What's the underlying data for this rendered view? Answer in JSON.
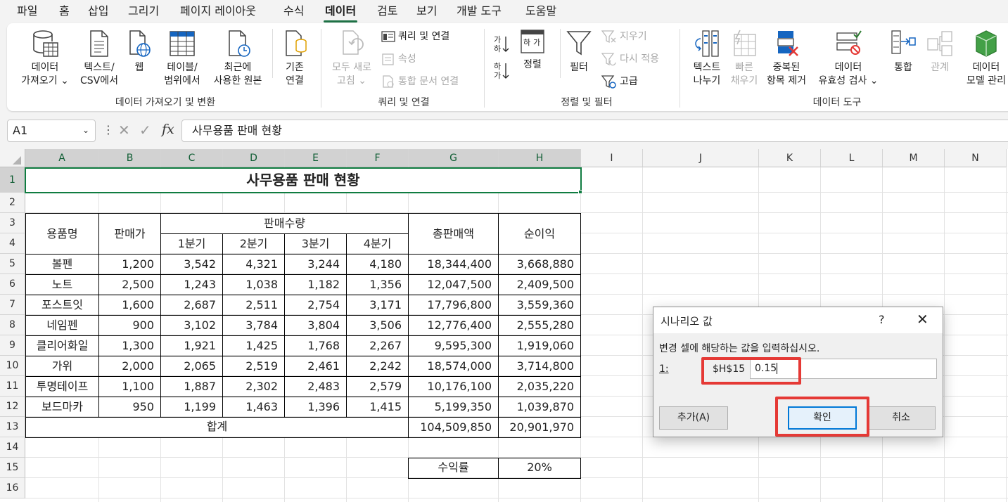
{
  "menu_tabs": [
    "파일",
    "홈",
    "삽입",
    "그리기",
    "페이지 레이아웃",
    "수식",
    "데이터",
    "검토",
    "보기",
    "개발 도구",
    "도움말"
  ],
  "active_tab": "데이터",
  "ribbon": {
    "get_data": {
      "line1": "데이터",
      "line2": "가져오기 ⌄"
    },
    "from_text": {
      "line1": "텍스트/",
      "line2": "CSV에서"
    },
    "web": {
      "line1": "웹"
    },
    "from_table": {
      "line1": "테이블/",
      "line2": "범위에서"
    },
    "recent_sources": {
      "line1": "최근에",
      "line2": "사용한 원본"
    },
    "existing_conn": {
      "line1": "기존",
      "line2": "연결"
    },
    "refresh_all": {
      "line1": "모두 새로",
      "line2": "고침 ⌄"
    },
    "queries_conn": "쿼리 및 연결",
    "properties": "속성",
    "edit_links": "통합 문서 연결",
    "sort_label": "정렬",
    "filter_label": "필터",
    "clear": "지우기",
    "reapply": "다시 적용",
    "advanced": "고급",
    "text_to_col": {
      "line1": "텍스트",
      "line2": "나누기"
    },
    "flash_fill": {
      "line1": "빠른",
      "line2": "채우기"
    },
    "remove_dup": {
      "line1": "중복된",
      "line2": "항목 제거"
    },
    "validation": {
      "line1": "데이터",
      "line2": "유효성 검사 ⌄"
    },
    "consolidate": {
      "line1": "통합"
    },
    "relationships": {
      "line1": "관계"
    },
    "data_model": {
      "line1": "데이터",
      "line2": "모델 관리"
    },
    "groups": {
      "get_transform": "데이터 가져오기 및 변환",
      "queries": "쿼리 및 연결",
      "sort_filter": "정렬 및 필터",
      "data_tools": "데이터 도구"
    }
  },
  "formula_bar": {
    "name_box": "A1",
    "formula": "사무용품 판매 현황"
  },
  "columns": [
    "A",
    "B",
    "C",
    "D",
    "E",
    "F",
    "G",
    "H",
    "I",
    "J",
    "K",
    "L",
    "M",
    "N"
  ],
  "rows": [
    "1",
    "2",
    "3",
    "4",
    "5",
    "6",
    "7",
    "8",
    "9",
    "10",
    "11",
    "12",
    "13",
    "14",
    "15",
    "16"
  ],
  "sheet": {
    "title": "사무용품 판매 현황",
    "headers": {
      "item": "용품명",
      "price": "판매가",
      "qty": "판매수량",
      "q1": "1분기",
      "q2": "2분기",
      "q3": "3분기",
      "q4": "4분기",
      "total": "총판매액",
      "profit": "순이익"
    },
    "data": [
      {
        "name": "볼펜",
        "price": "1,200",
        "q1": "3,542",
        "q2": "4,321",
        "q3": "3,244",
        "q4": "4,180",
        "total": "18,344,400",
        "profit": "3,668,880"
      },
      {
        "name": "노트",
        "price": "2,500",
        "q1": "1,243",
        "q2": "1,038",
        "q3": "1,182",
        "q4": "1,356",
        "total": "12,047,500",
        "profit": "2,409,500"
      },
      {
        "name": "포스트잇",
        "price": "1,600",
        "q1": "2,687",
        "q2": "2,511",
        "q3": "2,754",
        "q4": "3,171",
        "total": "17,796,800",
        "profit": "3,559,360"
      },
      {
        "name": "네임펜",
        "price": "900",
        "q1": "3,102",
        "q2": "3,784",
        "q3": "3,804",
        "q4": "3,506",
        "total": "12,776,400",
        "profit": "2,555,280"
      },
      {
        "name": "클리어화일",
        "price": "1,300",
        "q1": "1,921",
        "q2": "1,425",
        "q3": "1,768",
        "q4": "2,267",
        "total": "9,595,300",
        "profit": "1,919,060"
      },
      {
        "name": "가위",
        "price": "2,000",
        "q1": "2,065",
        "q2": "2,519",
        "q3": "2,461",
        "q4": "2,242",
        "total": "18,574,000",
        "profit": "3,714,800"
      },
      {
        "name": "투명테이프",
        "price": "1,100",
        "q1": "1,887",
        "q2": "2,302",
        "q3": "2,483",
        "q4": "2,579",
        "total": "10,176,100",
        "profit": "2,035,220"
      },
      {
        "name": "보드마카",
        "price": "950",
        "q1": "1,199",
        "q2": "1,463",
        "q3": "1,396",
        "q4": "1,415",
        "total": "5,199,350",
        "profit": "1,039,870"
      }
    ],
    "sum_label": "합계",
    "sum_total": "104,509,850",
    "sum_profit": "20,901,970",
    "rate_label": "수익률",
    "rate_value": "20%"
  },
  "dialog": {
    "title": "시나리오 값",
    "help": "?",
    "close": "✕",
    "prompt": "변경 셀에 해당하는 값을 입력하십시오.",
    "row_label": "1:",
    "cell_ref": "$H$15",
    "value": "0.15",
    "add_label": "추가(A)",
    "ok_label": "확인",
    "cancel_label": "취소"
  }
}
